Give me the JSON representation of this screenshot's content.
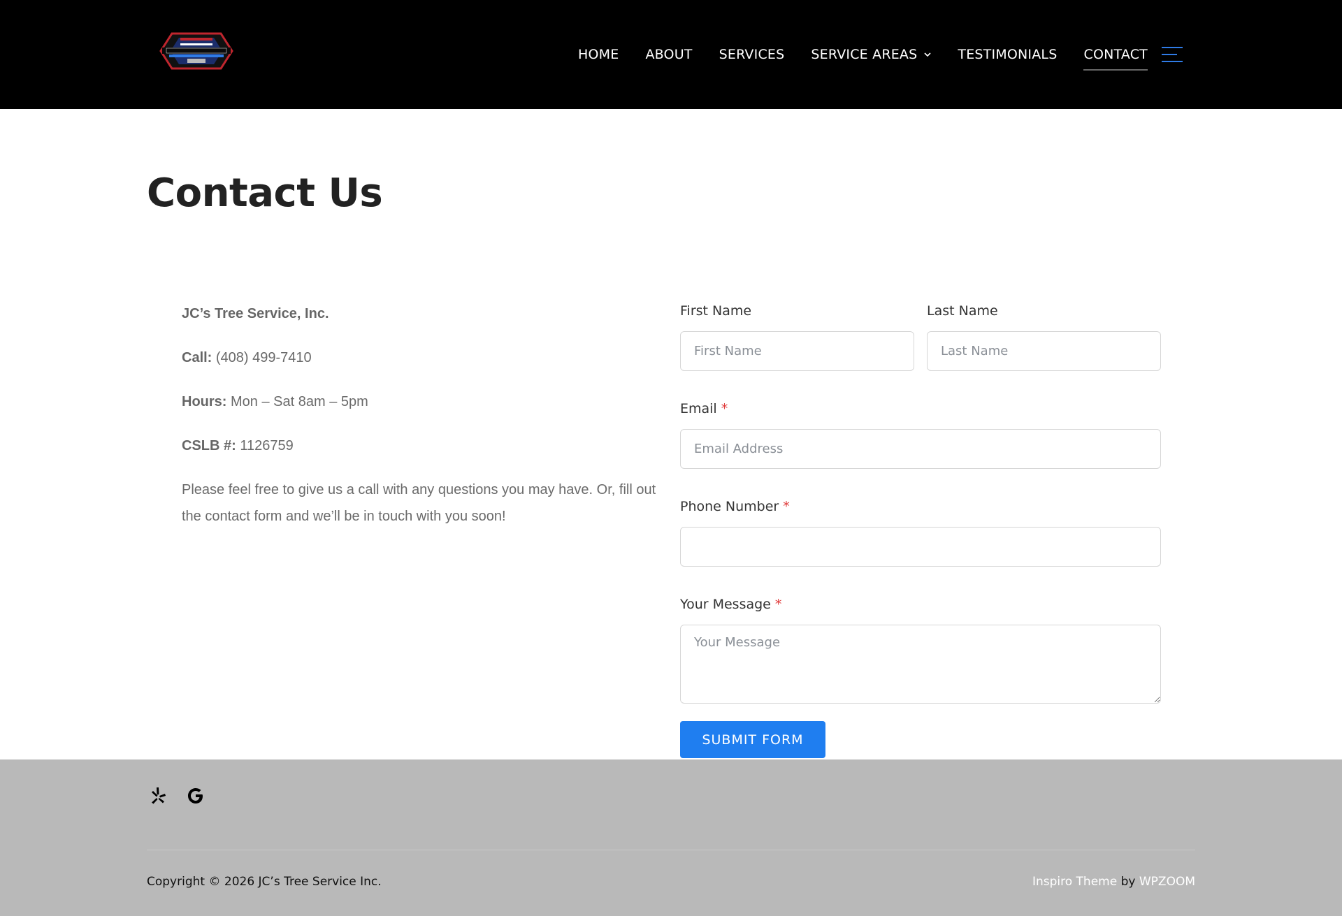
{
  "header": {
    "logo_icon": "jcs-tree-service-logo",
    "nav": [
      {
        "label": "HOME"
      },
      {
        "label": "ABOUT"
      },
      {
        "label": "SERVICES"
      },
      {
        "label": "SERVICE AREAS",
        "has_dropdown": true
      },
      {
        "label": "TESTIMONIALS"
      },
      {
        "label": "CONTACT",
        "active": true
      }
    ],
    "menu_icon": "hamburger-icon",
    "menu_color": "#2f7be6"
  },
  "page": {
    "title": "Contact Us"
  },
  "info": {
    "company": "JC’s Tree Service, Inc.",
    "call_label": "Call:",
    "call_value": " (408) 499-7410",
    "hours_label": "Hours:",
    "hours_value": " Mon – Sat 8am – 5pm",
    "cslb_label": "CSLB #:",
    "cslb_value": " 1126759",
    "message": "Please feel free to give us a call with any questions you may have. Or, fill out the contact form and we’ll be in touch with you soon!"
  },
  "form": {
    "first_name": {
      "label": "First Name",
      "placeholder": "First Name",
      "value": ""
    },
    "last_name": {
      "label": "Last Name",
      "placeholder": "Last Name",
      "value": ""
    },
    "email": {
      "label": "Email",
      "required_mark": "*",
      "placeholder": "Email Address",
      "value": ""
    },
    "phone": {
      "label": "Phone Number",
      "required_mark": "*",
      "placeholder": "",
      "value": ""
    },
    "message": {
      "label": "Your Message",
      "required_mark": "*",
      "placeholder": "Your Message",
      "value": ""
    },
    "submit_label": "SUBMIT FORM",
    "submit_color": "#1f7ef0",
    "required_color": "#e03b3b"
  },
  "footer": {
    "social_icons": [
      "yelp-icon",
      "google-icon"
    ],
    "copyright": "Copyright © 2026 JC’s Tree Service Inc.",
    "theme_link": "Inspiro Theme",
    "by_text": " by ",
    "vendor_link": "WPZOOM",
    "background": "#b9b9b9"
  }
}
